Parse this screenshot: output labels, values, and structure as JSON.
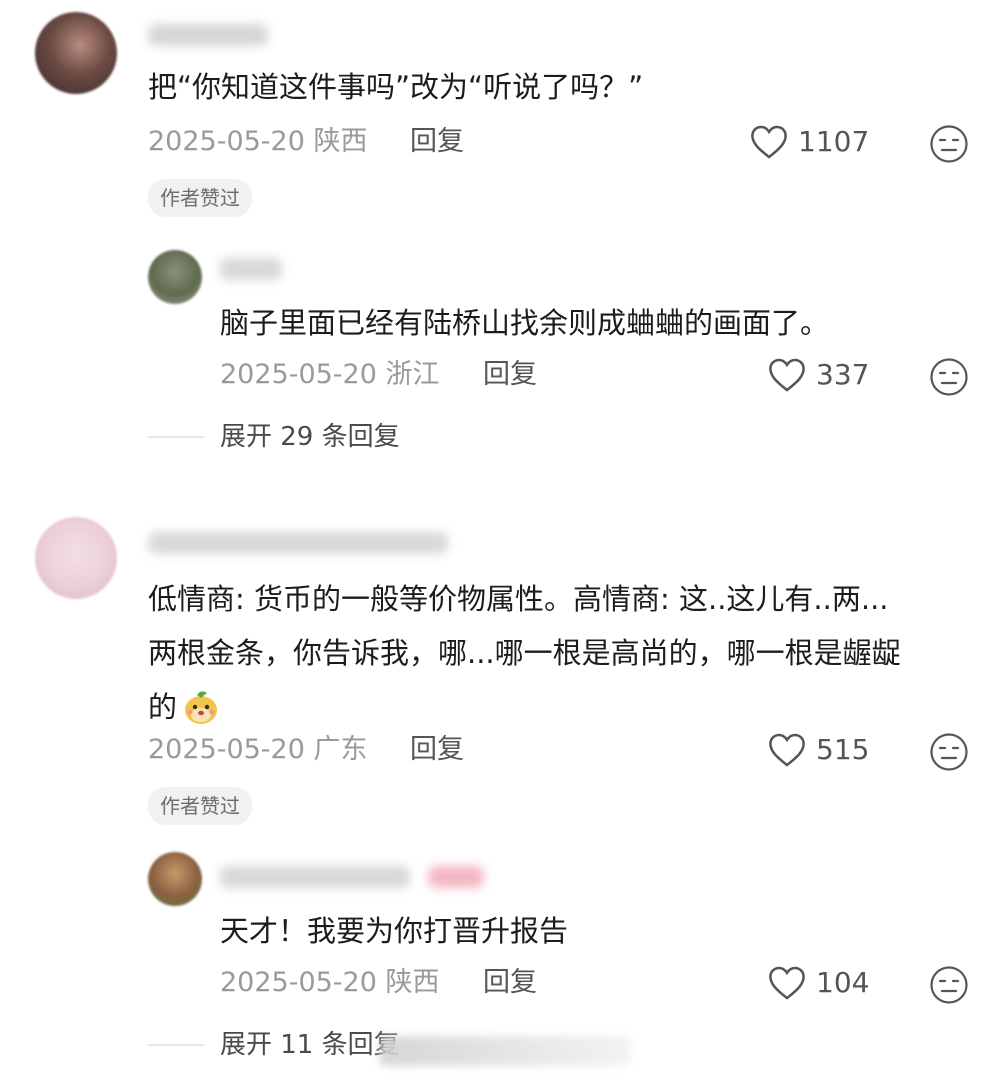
{
  "colors": {
    "text_primary": "#1c1c1c",
    "text_meta": "#9a9a9a",
    "badge_bg": "#f1f1f1",
    "icon_stroke": "#555555"
  },
  "comments": [
    {
      "text": "把“你知道这件事吗”改为“听说了吗？”",
      "date": "2025-05-20",
      "location": "陕西",
      "reply_label": "回复",
      "likes": "1107",
      "badge": "作者赞过",
      "replies": [
        {
          "text": "脑子里面已经有陆桥山找余则成蛐蛐的画面了。",
          "date": "2025-05-20",
          "location": "浙江",
          "reply_label": "回复",
          "likes": "337"
        }
      ],
      "expand_label": "展开 29 条回复"
    },
    {
      "text_lines": [
        "低情商: 货币的一般等价物属性。高情商: 这..这儿有..两...",
        "两根金条，你告诉我，哪...哪一根是高尚的，哪一根是龌龊",
        "的"
      ],
      "date": "2025-05-20",
      "location": "广东",
      "reply_label": "回复",
      "likes": "515",
      "badge": "作者赞过",
      "replies": [
        {
          "text": "天才！我要为你打晋升报告",
          "date": "2025-05-20",
          "location": "陕西",
          "reply_label": "回复",
          "likes": "104"
        }
      ],
      "expand_label": "展开 11 条回复"
    }
  ],
  "icons": {
    "like": "heart-outline-icon",
    "dislike": "meh-face-icon",
    "emoji": "mascot-emoji-icon"
  }
}
